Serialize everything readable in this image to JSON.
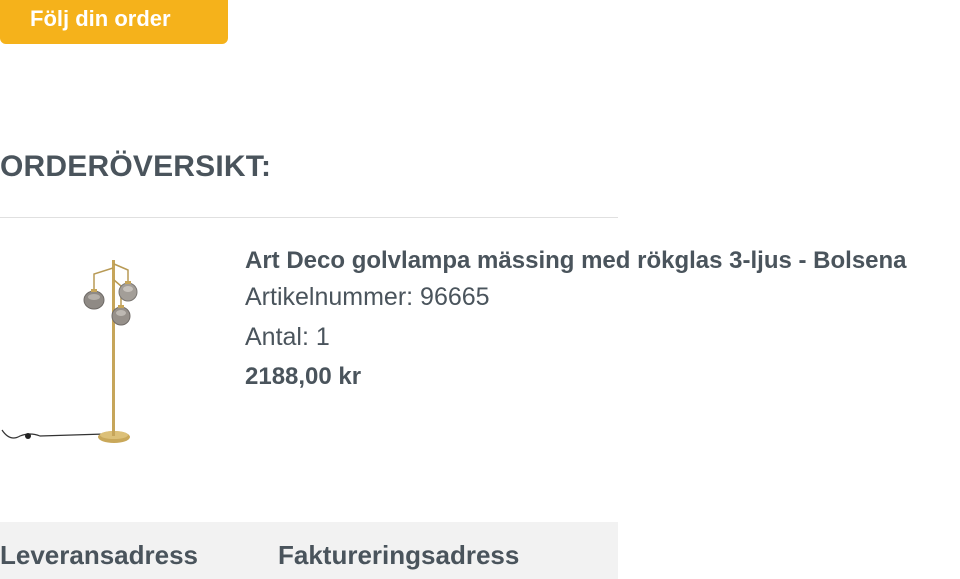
{
  "track_button": {
    "label": "Följ din order"
  },
  "order_summary": {
    "title": "ORDERÖVERSIKT:"
  },
  "product": {
    "name": "Art Deco golvlampa mässing med rökglas 3-ljus - Bolsena",
    "article_number": "Artikelnummer: 96665",
    "quantity": "Antal: 1",
    "price": "2188,00 kr"
  },
  "addresses": {
    "delivery_label": "Leveransadress",
    "billing_label": "Faktureringsadress"
  },
  "colors": {
    "accent": "#f5b21b",
    "text": "#4a545c",
    "address_bg": "#f2f2f2"
  }
}
